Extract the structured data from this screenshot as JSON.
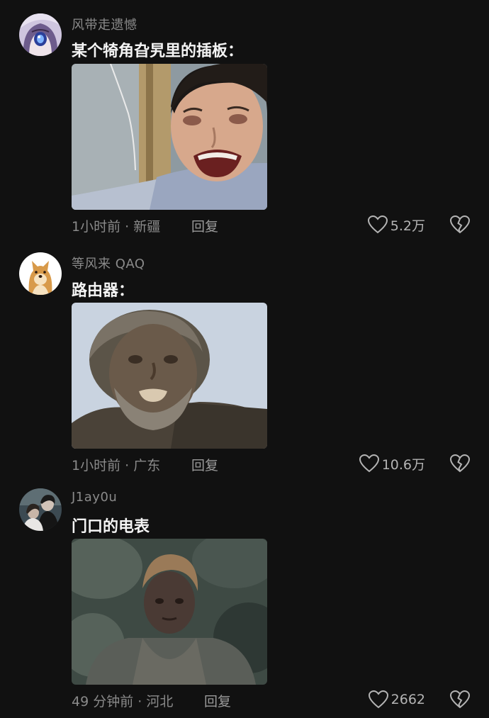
{
  "colors": {
    "background": "#111111",
    "text_primary": "#f4f4f4",
    "text_secondary": "#8a8a8a",
    "icon": "#b4b4b4"
  },
  "comments": [
    {
      "username": "风带走遗憾",
      "text": "某个犄角旮旯里的插板：",
      "time_location": "1小时前 · 新疆",
      "reply_label": "回复",
      "likes": "5.2万",
      "avatar_icon": "anime-girl-avatar",
      "like_icon": "heart-outline-icon",
      "dislike_icon": "broken-heart-icon"
    },
    {
      "username": "等风来 QAQ",
      "text": "路由器：",
      "time_location": "1小时前 · 广东",
      "reply_label": "回复",
      "likes": "10.6万",
      "avatar_icon": "shiba-dog-avatar",
      "like_icon": "heart-outline-icon",
      "dislike_icon": "broken-heart-icon"
    },
    {
      "username": "J1ay0u",
      "text": "门口的电表",
      "time_location": "49 分钟前 · 河北",
      "reply_label": "回复",
      "likes": "2662",
      "avatar_icon": "couple-avatar",
      "like_icon": "heart-outline-icon",
      "dislike_icon": "broken-heart-icon"
    }
  ]
}
